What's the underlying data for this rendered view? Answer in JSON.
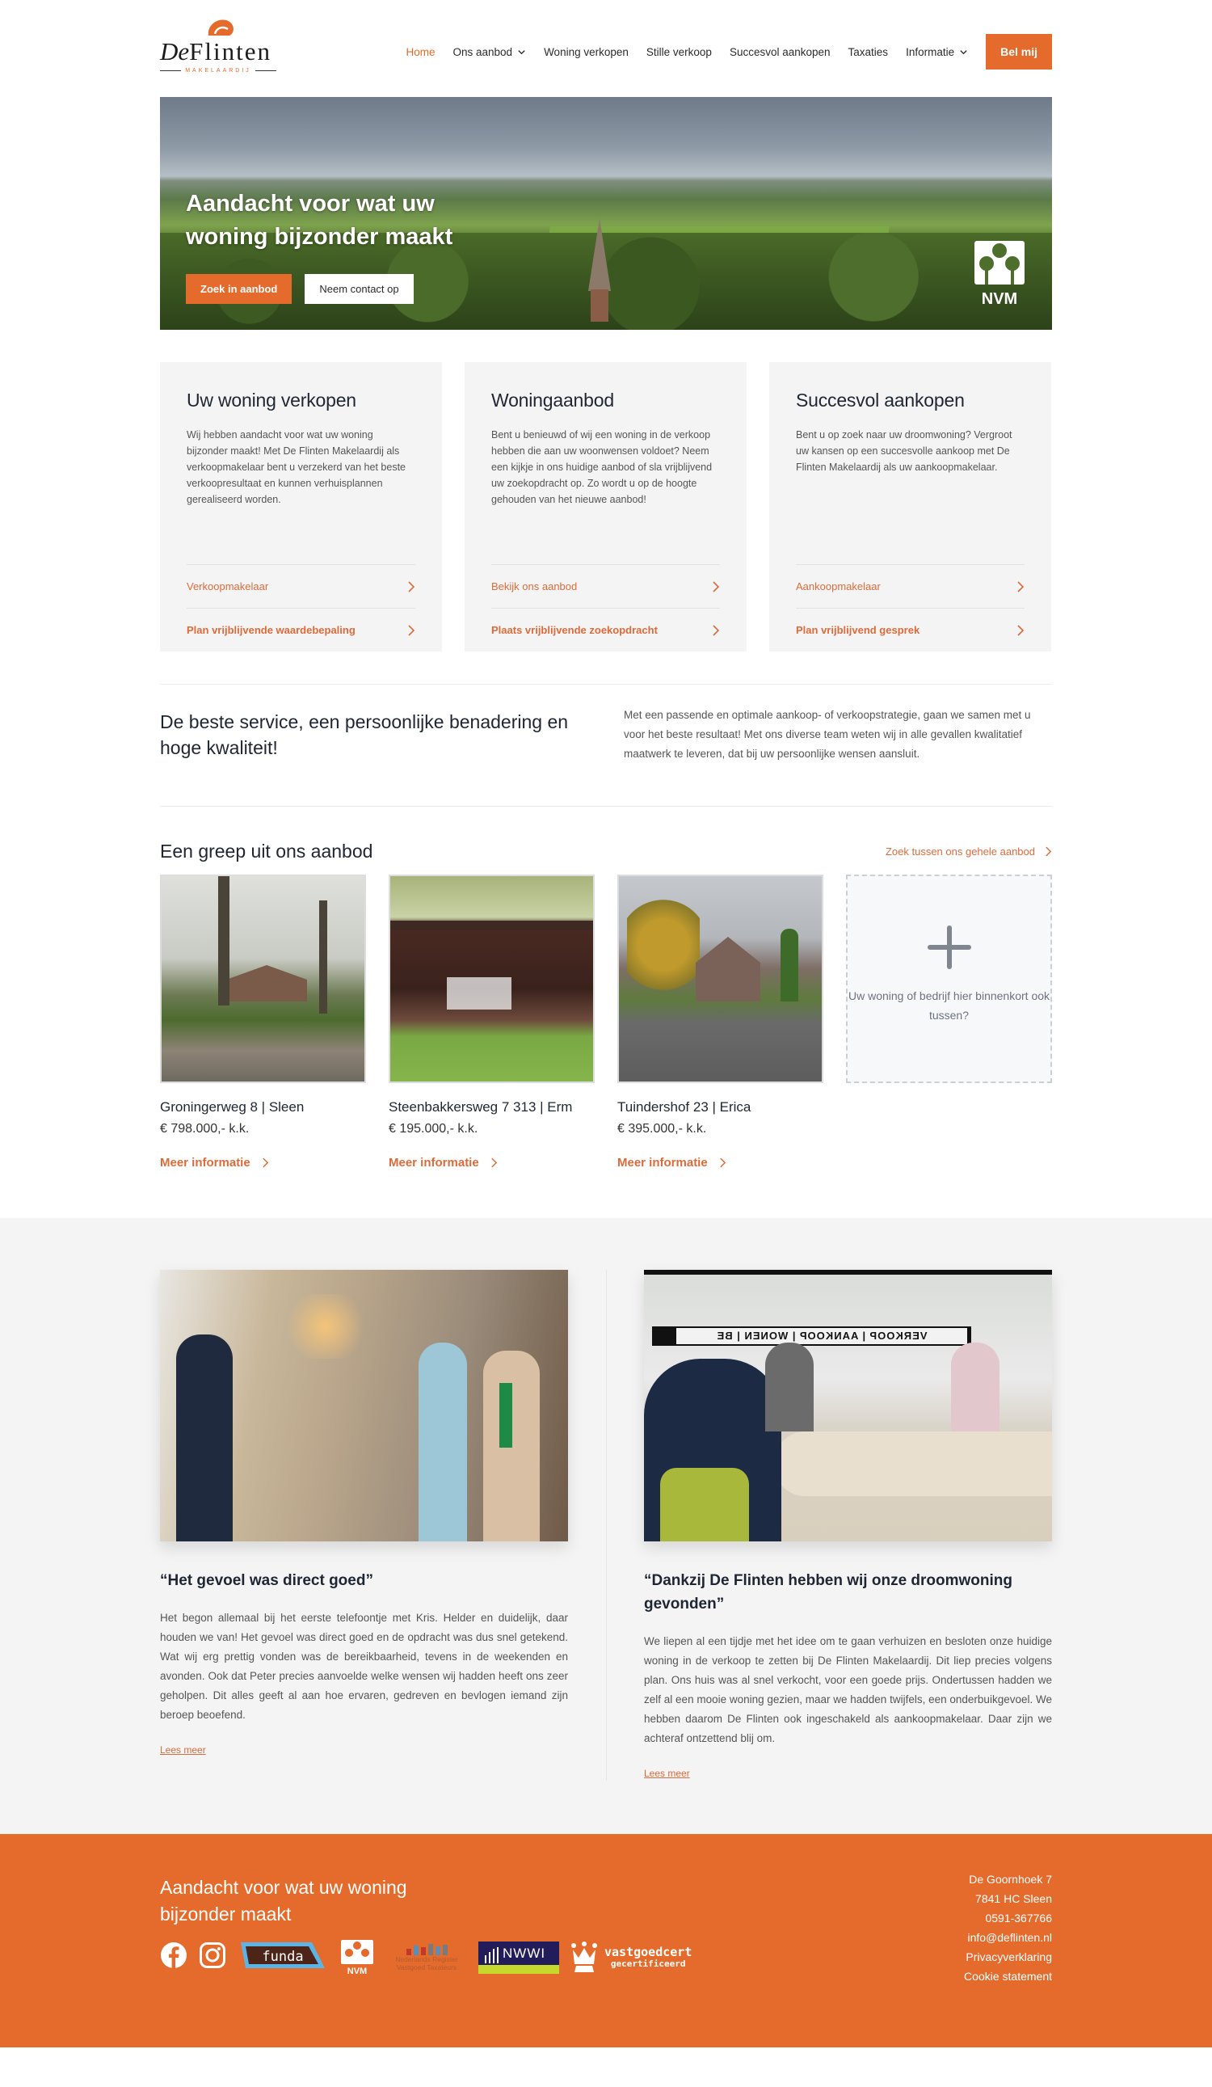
{
  "header": {
    "logo": {
      "name": "DeFlinten",
      "name_prefix": "De",
      "name_rest": "Flinten",
      "subtitle": "MAKELAARDIJ"
    },
    "nav": [
      {
        "label": "Home",
        "active": true,
        "dropdown": false
      },
      {
        "label": "Ons aanbod",
        "active": false,
        "dropdown": true
      },
      {
        "label": "Woning verkopen",
        "active": false,
        "dropdown": false
      },
      {
        "label": "Stille verkoop",
        "active": false,
        "dropdown": false
      },
      {
        "label": "Succesvol aankopen",
        "active": false,
        "dropdown": false
      },
      {
        "label": "Taxaties",
        "active": false,
        "dropdown": false
      },
      {
        "label": "Informatie",
        "active": false,
        "dropdown": true
      }
    ],
    "call_button": "Bel mij"
  },
  "hero": {
    "title": "Aandacht voor wat uw woning bijzonder maakt",
    "primary_button": "Zoek in aanbod",
    "secondary_button": "Neem contact op",
    "badge": "NVM"
  },
  "services": [
    {
      "title": "Uw woning verkopen",
      "text": "Wij hebben aandacht voor wat uw woning bijzonder maakt! Met De Flinten Makelaardij als verkoopmakelaar bent u verzekerd van het beste verkoopresultaat en kunnen verhuisplannen gerealiseerd worden.",
      "link1": "Verkoopmakelaar",
      "link2": "Plan vrijblijvende waardebepaling"
    },
    {
      "title": "Woningaanbod",
      "text": "Bent u benieuwd of wij een woning in de verkoop hebben die aan uw woonwensen voldoet? Neem een kijkje in ons huidige aanbod of sla vrijblijvend uw zoekopdracht op. Zo wordt u op de hoogte gehouden van het nieuwe aanbod!",
      "link1": "Bekijk ons aanbod",
      "link2": "Plaats vrijblijvende zoekopdracht"
    },
    {
      "title": "Succesvol aankopen",
      "text": "Bent u op zoek naar uw droomwoning? Vergroot uw kansen op een succesvolle aankoop met De Flinten Makelaardij als uw aankoopmakelaar.",
      "link1": "Aankoopmakelaar",
      "link2": "Plan vrijblijvend gesprek"
    }
  ],
  "intro": {
    "heading": "De beste service, een persoonlijke benadering en hoge kwaliteit!",
    "text": "Met een passende en optimale aankoop- of verkoopstrategie, gaan we samen met u voor het beste resultaat! Met ons diverse team weten wij in alle gevallen kwalitatief maatwerk te leveren, dat bij uw persoonlijke wensen aansluit."
  },
  "listings": {
    "heading": "Een greep uit ons aanbod",
    "all_link": "Zoek tussen ons gehele aanbod",
    "items": [
      {
        "address": "Groningerweg 8 | Sleen",
        "price": "€ 798.000,- k.k.",
        "more": "Meer informatie"
      },
      {
        "address": "Steenbakkersweg 7 313 | Erm",
        "price": "€ 195.000,- k.k.",
        "more": "Meer informatie"
      },
      {
        "address": "Tuindershof 23 | Erica",
        "price": "€ 395.000,- k.k.",
        "more": "Meer informatie"
      }
    ],
    "placeholder": "Uw woning of bedrijf hier binnenkort ook tussen?"
  },
  "testimonials": [
    {
      "title": "“Het gevoel was direct goed”",
      "text": "Het begon allemaal bij het eerste telefoontje met Kris. Helder en duidelijk, daar houden we van! Het gevoel was direct goed en de opdracht was dus snel getekend. Wat wij erg prettig vonden was de bereikbaarheid, tevens in de weekenden en avonden. Ook dat Peter precies aanvoelde welke wensen wij hadden heeft ons zeer geholpen. Dit alles geeft al aan hoe ervaren, gedreven en bevlogen iemand zijn beroep beoefend.",
      "read_more": "Lees meer"
    },
    {
      "title": "“Dankzij De Flinten hebben wij onze droomwoning gevonden”",
      "text": "We liepen al een tijdje met het idee om te gaan verhuizen en besloten onze huidige woning in de verkoop te zetten bij De Flinten Makelaardij. Dit liep precies volgens plan. Ons huis was al snel verkocht, voor een goede prijs. Ondertussen hadden we zelf al een mooie woning gezien, maar we hadden twijfels, een onderbuikgevoel. We hebben daarom De Flinten ook ingeschakeld als aankoopmakelaar. Daar zijn we achteraf ontzettend blij om.",
      "read_more": "Lees meer",
      "sign_text": "VERKOOP | AANKOOP | WONEN | BE"
    }
  ],
  "footer": {
    "title": "Aandacht voor wat uw woning bijzonder maakt",
    "logos": {
      "funda": "funda",
      "nvm": "NVM",
      "nrvt_line1": "Nederlands Register",
      "nrvt_line2": "Vastgoed Taxateurs",
      "nwwi": "NWWI",
      "vastgoedcert_line1": "vastgoedcert",
      "vastgoedcert_line2": "gecertificeerd"
    },
    "contact": {
      "street": "De Goornhoek 7",
      "city": "7841 HC Sleen",
      "phone": "0591-367766",
      "email": "info@deflinten.nl",
      "privacy": "Privacyverklaring",
      "cookies": "Cookie statement"
    }
  },
  "colors": {
    "accent": "#e46b2b",
    "link": "#dd6b3a",
    "heading": "#1e2633",
    "panel": "#f4f4f4"
  }
}
